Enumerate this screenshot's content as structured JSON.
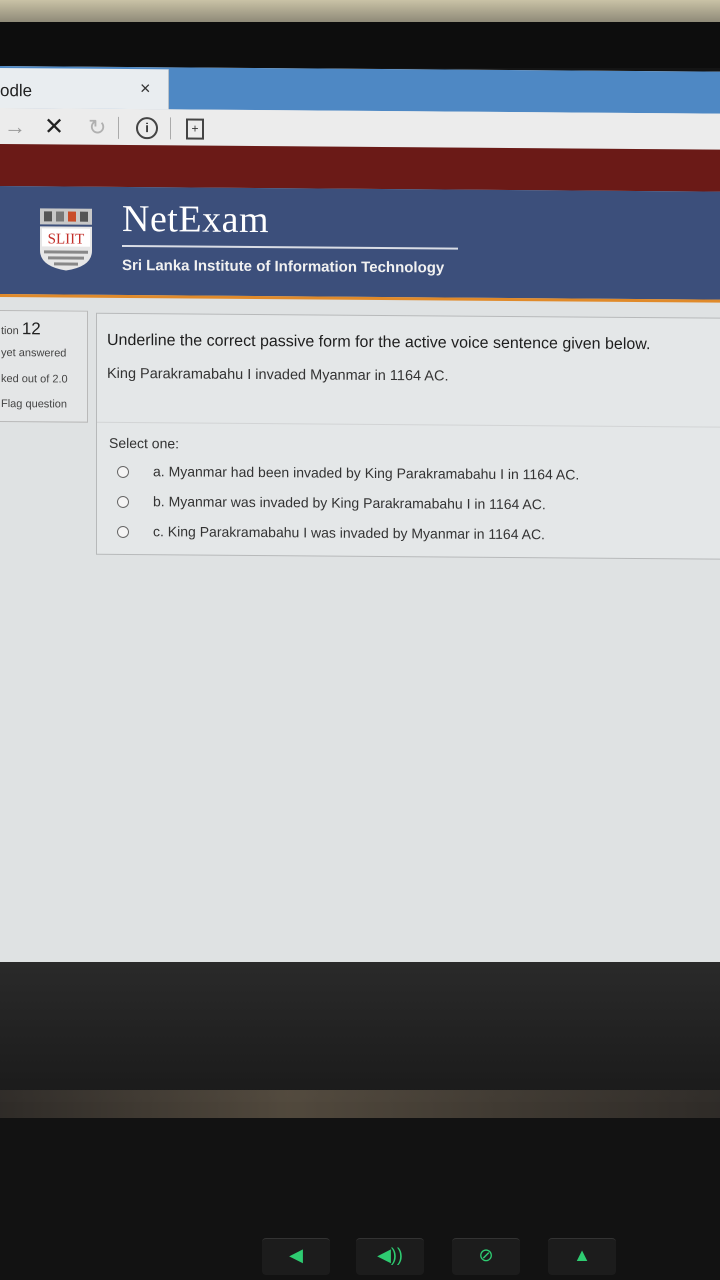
{
  "browser": {
    "tab_title": "odle",
    "tab_close": "×"
  },
  "site": {
    "logo_text": "SLIIT",
    "brand": "NetExam",
    "subtitle": "Sri Lanka Institute of Information Technology",
    "colors": {
      "header": "#3c4f7b",
      "redbar": "#6b1a17",
      "accent": "#e08a2a"
    }
  },
  "question_info": {
    "label": "tion",
    "number": "12",
    "status": "yet answered",
    "marks": "ked out of 2.0",
    "flag": "Flag question"
  },
  "question": {
    "text": "Underline the correct passive form for the active voice sentence given below.",
    "sentence": "King Parakramabahu I invaded Myanmar in 1164 AC.",
    "select_label": "Select one:",
    "options": [
      {
        "label": "a. Myanmar had been invaded by King Parakramabahu I  in 1164 AC.",
        "selected": false
      },
      {
        "label": "b. Myanmar was invaded by King Parakramabahu I  in 1164 AC.",
        "selected": false
      },
      {
        "label": "c. King Parakramabahu I was invaded by Myanmar  in 1164 AC.",
        "selected": false
      }
    ]
  },
  "icons": [
    "forward-icon",
    "stop-icon",
    "refresh-icon",
    "info-icon",
    "page-icon",
    "volume-down-icon",
    "volume-up-icon",
    "mic-mute-icon",
    "eject-icon"
  ]
}
